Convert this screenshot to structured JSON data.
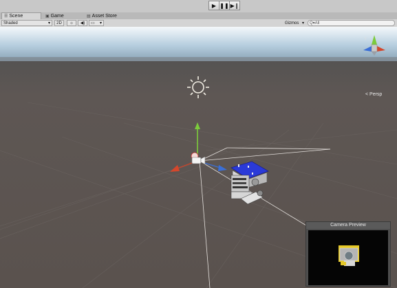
{
  "playbar": {
    "play_icon": "play-icon",
    "pause_icon": "pause-icon",
    "step_icon": "step-icon"
  },
  "tabs": [
    {
      "label": "Scene",
      "icon": "scene-icon",
      "active": true
    },
    {
      "label": "Game",
      "icon": "game-icon",
      "active": false
    },
    {
      "label": "Asset Store",
      "icon": "store-icon",
      "active": false
    }
  ],
  "toolbar": {
    "draw_mode": "Shaded",
    "mode_2d": "2D",
    "lighting_icon": "sun-icon",
    "audio_icon": "speaker-icon",
    "effects_icon": "image-icon",
    "gizmos": "Gizmos",
    "search_placeholder": "Q▾All"
  },
  "scene": {
    "projection_label": "< Persp",
    "sky_color": "#a9c3d6",
    "ground_color": "#5b5450"
  },
  "camera_preview": {
    "title": "Camera Preview"
  }
}
